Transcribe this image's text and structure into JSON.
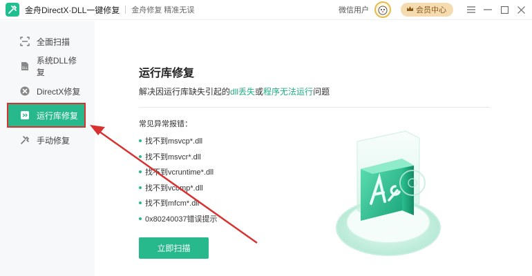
{
  "titlebar": {
    "app_title": "金舟DirectX·DLL一键修复",
    "slogan": "金舟修复 精准无误",
    "user_label": "微信用户",
    "vip_label": "会员中心"
  },
  "sidebar": {
    "items": [
      {
        "label": "全面扫描",
        "icon": "scan-icon"
      },
      {
        "label": "系统DLL修复",
        "icon": "dll-icon"
      },
      {
        "label": "DirectX修复",
        "icon": "directx-icon"
      },
      {
        "label": "运行库修复",
        "icon": "runtime-icon"
      },
      {
        "label": "手动修复",
        "icon": "wrench-icon"
      }
    ],
    "active_index": 3
  },
  "main": {
    "heading": "运行库修复",
    "desc_prefix": "解决因运行库缺失引起的",
    "desc_hl1": "dll丢失",
    "desc_mid": "或",
    "desc_hl2": "程序无法运行",
    "desc_suffix": "问题",
    "common_label": "常见异常报错：",
    "errors": [
      "找不到msvcp*.dll",
      "找不到msvcr*.dll",
      "找不到vcruntime*.dll",
      "找不到vcomp*.dll",
      "找不到mfcm*.dll",
      "0x80240037错误提示"
    ],
    "scan_button": "立即扫描"
  },
  "colors": {
    "accent": "#27b98b",
    "highlight_box": "#d8312f",
    "arrow": "#d8312f",
    "vip_bg": "#f4dcb0"
  }
}
